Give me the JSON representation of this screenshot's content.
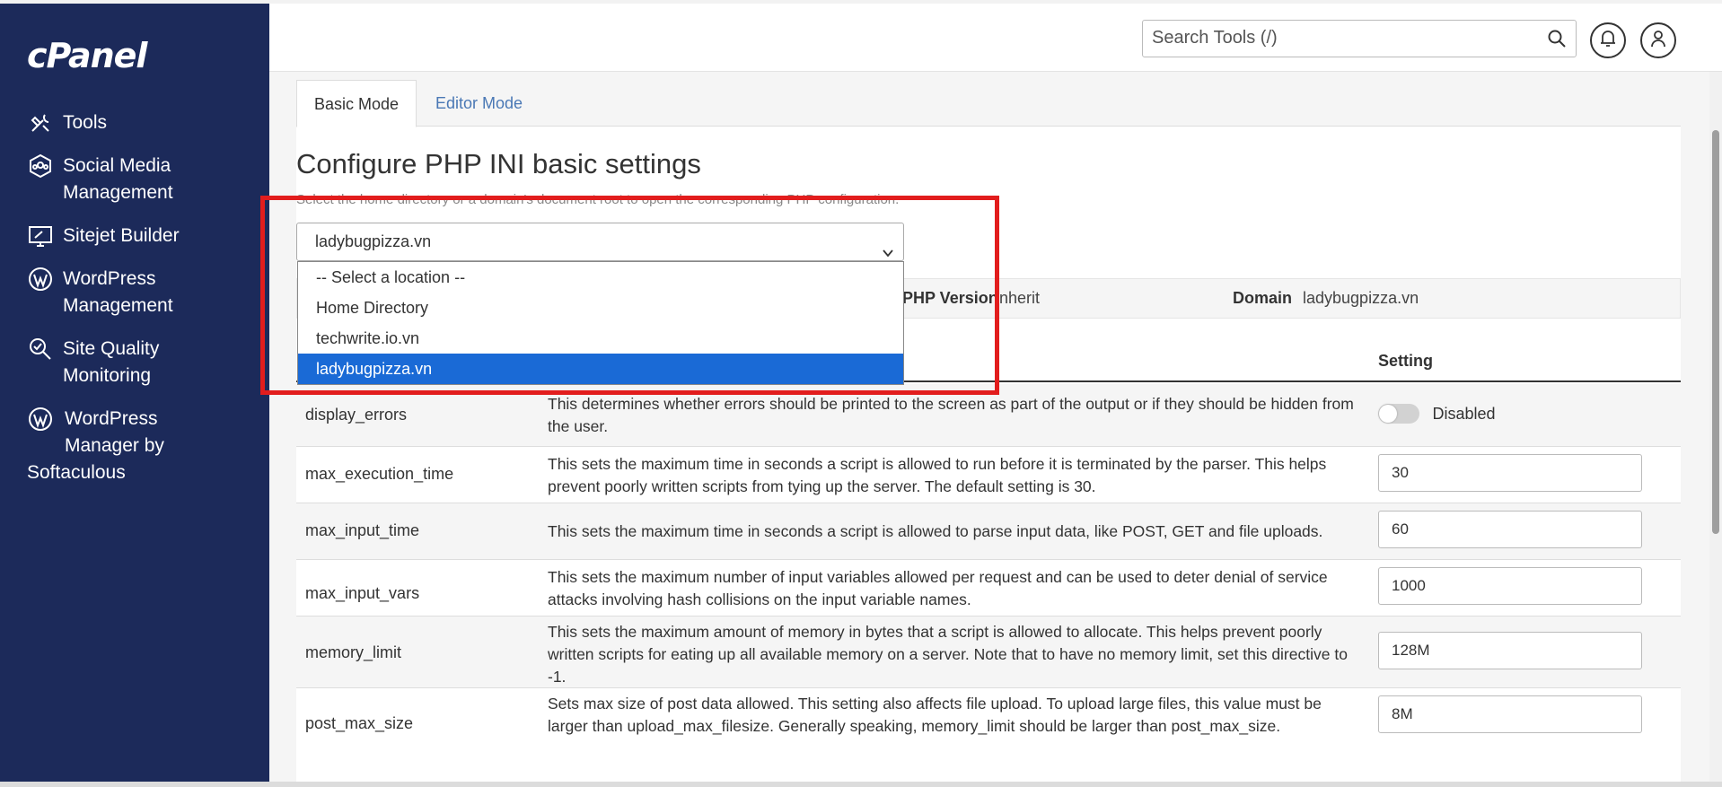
{
  "sidebar": {
    "logo": "cPanel",
    "items": [
      {
        "label": "Tools",
        "icon": "tools-icon"
      },
      {
        "label": "Social Media Management",
        "line1": "Social Media",
        "line2": "Management",
        "icon": "social-media-icon"
      },
      {
        "label": "Sitejet Builder",
        "icon": "sitejet-icon"
      },
      {
        "label": "WordPress Management",
        "line1": "WordPress",
        "line2": "Management",
        "icon": "wordpress-icon"
      },
      {
        "label": "Site Quality Monitoring",
        "line1": "Site Quality",
        "line2": "Monitoring",
        "icon": "site-quality-icon"
      },
      {
        "label": "WordPress Manager by Softaculous",
        "line1": "WordPress",
        "line2": "Manager by",
        "line3": "Softaculous",
        "icon": "wordpress-icon"
      }
    ]
  },
  "header": {
    "search_placeholder": "Search Tools (/)"
  },
  "tabs": [
    {
      "label": "Basic Mode",
      "active": true
    },
    {
      "label": "Editor Mode",
      "active": false
    }
  ],
  "page": {
    "title": "Configure PHP INI basic settings",
    "subtitle": "Select the home directory or a domain's document root to open the corresponding PHP configuration."
  },
  "location_select": {
    "selected": "ladybugpizza.vn",
    "options": [
      "-- Select a location --",
      "Home Directory",
      "techwrite.io.vn",
      "ladybugpizza.vn"
    ]
  },
  "info_bar": {
    "php_version_label": "PHP Version",
    "php_version_value": "inherit",
    "domain_label": "Domain",
    "domain_value": "ladybugpizza.vn"
  },
  "table": {
    "setting_header": "Setting",
    "rows": [
      {
        "name": "display_errors",
        "description": "This determines whether errors should be printed to the screen as part of the output or if they should be hidden from the user.",
        "type": "toggle",
        "value": "Disabled"
      },
      {
        "name": "max_execution_time",
        "description": "This sets the maximum time in seconds a script is allowed to run before it is terminated by the parser. This helps prevent poorly written scripts from tying up the server. The default setting is 30.",
        "type": "input",
        "value": "30"
      },
      {
        "name": "max_input_time",
        "description": "This sets the maximum time in seconds a script is allowed to parse input data, like POST, GET and file uploads.",
        "type": "input",
        "value": "60"
      },
      {
        "name": "max_input_vars",
        "description": "This sets the maximum number of input variables allowed per request and can be used to deter denial of service attacks involving hash collisions on the input variable names.",
        "type": "input",
        "value": "1000"
      },
      {
        "name": "memory_limit",
        "description": "This sets the maximum amount of memory in bytes that a script is allowed to allocate. This helps prevent poorly written scripts for eating up all available memory on a server. Note that to have no memory limit, set this directive to -1.",
        "type": "input",
        "value": "128M"
      },
      {
        "name": "post_max_size",
        "description": "Sets max size of post data allowed. This setting also affects file upload. To upload large files, this value must be larger than upload_max_filesize. Generally speaking, memory_limit should be larger than post_max_size.",
        "type": "input",
        "value": "8M"
      }
    ]
  },
  "colors": {
    "sidebar_bg": "#1c2a5a",
    "highlight": "#e21d1d",
    "selected_option": "#1a6ad6",
    "link": "#4a78b5"
  }
}
